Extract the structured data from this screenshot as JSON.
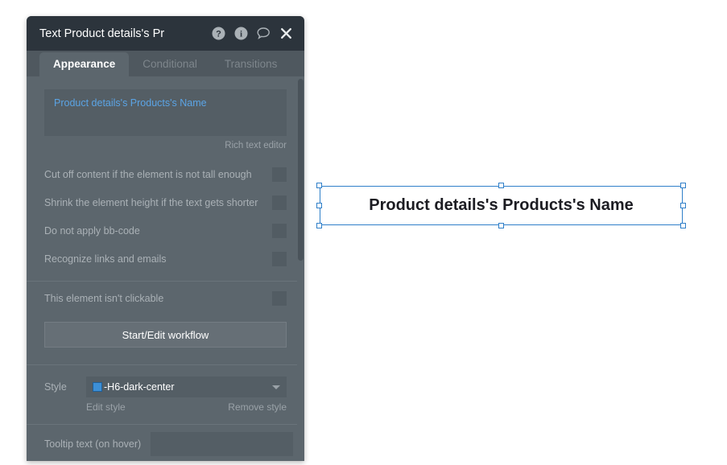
{
  "panel": {
    "title": "Text Product details's Pr",
    "header_icons": [
      {
        "name": "help-icon",
        "glyph": "question-circle"
      },
      {
        "name": "info-icon",
        "glyph": "info-circle"
      },
      {
        "name": "comment-icon",
        "glyph": "speech-bubble"
      },
      {
        "name": "close-icon",
        "glyph": "x"
      }
    ],
    "tabs": [
      {
        "label": "Appearance",
        "active": true
      },
      {
        "label": "Conditional",
        "active": false
      },
      {
        "label": "Transitions",
        "active": false
      }
    ],
    "editor": {
      "content": "Product details's Products's Name",
      "caption": "Rich text editor"
    },
    "checkboxes": [
      {
        "label": "Cut off content if the element is not tall enough",
        "checked": false
      },
      {
        "label": "Shrink the element height if the text gets shorter",
        "checked": false
      },
      {
        "label": "Do not apply bb-code",
        "checked": false
      },
      {
        "label": "Recognize links and emails",
        "checked": false
      }
    ],
    "clickable": {
      "label": "This element isn't clickable",
      "checked": false
    },
    "workflow_button": "Start/Edit workflow",
    "style": {
      "label": "Style",
      "value": "-H6-dark-center",
      "swatch_color": "#3d8fd6",
      "edit_link": "Edit style",
      "remove_link": "Remove style"
    },
    "tooltip": {
      "label": "Tooltip text (on hover)",
      "value": "",
      "placeholder": ""
    }
  },
  "canvas": {
    "element_text": "Product details's Products's Name",
    "selection_color": "#2f7fc9"
  }
}
